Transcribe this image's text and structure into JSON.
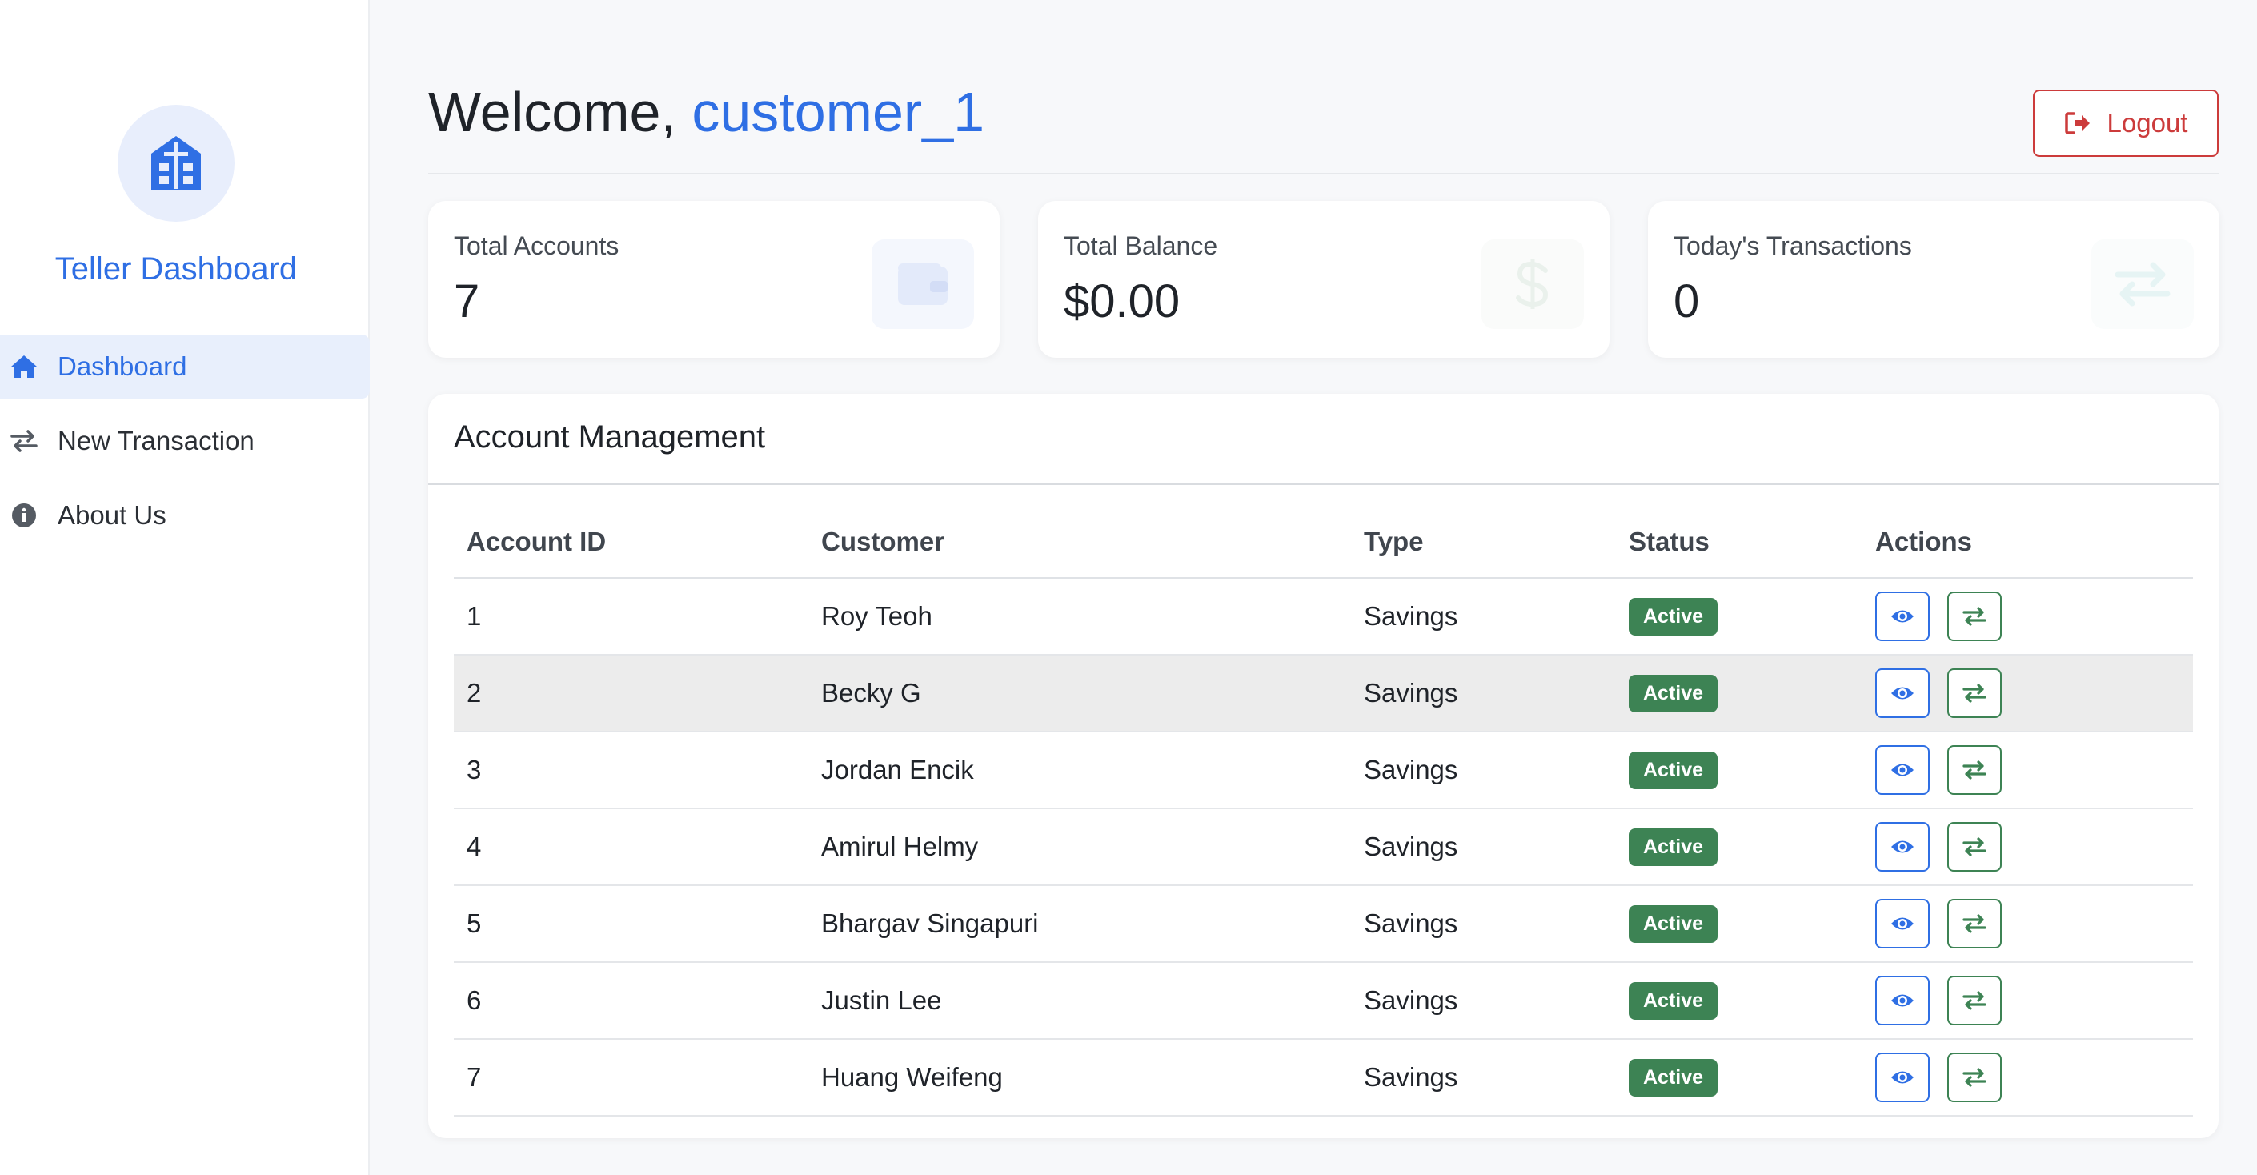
{
  "sidebar": {
    "brand_title": "Teller Dashboard",
    "items": [
      {
        "label": "Dashboard",
        "icon": "home-icon",
        "active": true
      },
      {
        "label": "New Transaction",
        "icon": "transfer-arrows-icon",
        "active": false
      },
      {
        "label": "About Us",
        "icon": "info-circle-icon",
        "active": false
      }
    ]
  },
  "header": {
    "welcome_prefix": "Welcome, ",
    "username": "customer_1",
    "logout_label": "Logout"
  },
  "stats": [
    {
      "label": "Total Accounts",
      "value": "7",
      "icon": "wallet-icon"
    },
    {
      "label": "Total Balance",
      "value": "$0.00",
      "icon": "dollar-icon"
    },
    {
      "label": "Today's Transactions",
      "value": "0",
      "icon": "exchange-icon"
    }
  ],
  "accounts": {
    "title": "Account Management",
    "columns": [
      "Account ID",
      "Customer",
      "Type",
      "Status",
      "Actions"
    ],
    "rows": [
      {
        "id": "1",
        "customer": "Roy Teoh",
        "type": "Savings",
        "status": "Active"
      },
      {
        "id": "2",
        "customer": "Becky G",
        "type": "Savings",
        "status": "Active"
      },
      {
        "id": "3",
        "customer": "Jordan Encik",
        "type": "Savings",
        "status": "Active"
      },
      {
        "id": "4",
        "customer": "Amirul Helmy",
        "type": "Savings",
        "status": "Active"
      },
      {
        "id": "5",
        "customer": "Bhargav Singapuri",
        "type": "Savings",
        "status": "Active"
      },
      {
        "id": "6",
        "customer": "Justin Lee",
        "type": "Savings",
        "status": "Active"
      },
      {
        "id": "7",
        "customer": "Huang Weifeng",
        "type": "Savings",
        "status": "Active"
      }
    ]
  },
  "colors": {
    "primary": "#2f6fe4",
    "danger": "#cc3b3b",
    "success": "#3d8354"
  }
}
